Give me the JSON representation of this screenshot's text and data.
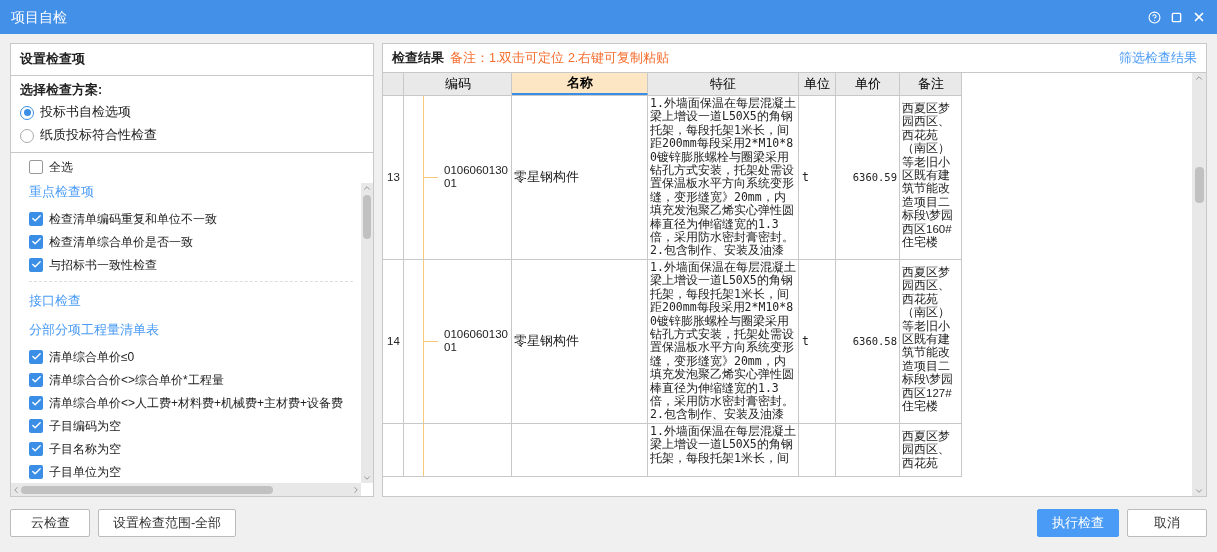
{
  "window": {
    "title": "项目自检"
  },
  "left": {
    "header": "设置检查项",
    "scheme_label": "选择检查方案:",
    "schemes": [
      {
        "label": "投标书自检选项",
        "selected": true
      },
      {
        "label": "纸质投标符合性检查",
        "selected": false
      }
    ],
    "select_all": {
      "label": "全选",
      "checked": false
    },
    "sections": [
      {
        "title": "重点检查项",
        "divider": true,
        "items": [
          {
            "label": "检查清单编码重复和单位不一致",
            "checked": true
          },
          {
            "label": "检查清单综合单价是否一致",
            "checked": true
          },
          {
            "label": "与招标书一致性检查",
            "checked": true
          }
        ]
      },
      {
        "title": "接口检查",
        "divider": false
      },
      {
        "title": "分部分项工程量清单表",
        "divider": false,
        "items": [
          {
            "label": "清单综合单价≤0",
            "checked": true
          },
          {
            "label": "清单综合合价<>综合单价*工程量",
            "checked": true
          },
          {
            "label": "清单综合单价<>人工费+材料费+机械费+主材费+设备费",
            "checked": true
          },
          {
            "label": "子目编码为空",
            "checked": true
          },
          {
            "label": "子目名称为空",
            "checked": true
          },
          {
            "label": "子目单位为空",
            "checked": true
          }
        ]
      }
    ]
  },
  "right": {
    "title": "检查结果",
    "note": "备注：1.双击可定位 2.右键可复制粘贴",
    "filter_link": "筛选检查结果",
    "columns": [
      {
        "selected": false
      },
      {
        "label": "编码",
        "selected": false
      },
      {
        "label": "名称",
        "selected": true
      },
      {
        "label": "特征",
        "selected": false
      },
      {
        "label": "单位",
        "selected": false
      },
      {
        "label": "单价",
        "selected": false
      },
      {
        "label": "备注",
        "selected": false
      }
    ],
    "rows": [
      {
        "number": "13",
        "code": "010606013001",
        "name": "零星钢构件",
        "feature": "1.外墙面保温在每层混凝土梁上增设一道L50X5的角钢托架，每段托架1米长，间距200mm每段采用2*M10*80镀锌膨胀螺栓与圈梁采用钻孔方式安装，托架处需设置保温板水平方向系统变形缝，变形缝宽》20mm，内填充发泡聚乙烯实心弹性圆棒直径为伸缩缝宽的1.3倍，采用防水密封膏密封。\n2.包含制作、安装及油漆",
        "unit": "t",
        "price": "6360.59",
        "remark": "西夏区梦园西区、西花苑（南区）等老旧小区既有建筑节能改造项目二标段\\梦园西区160#住宅楼"
      },
      {
        "number": "14",
        "code": "010606013001",
        "name": "零星钢构件",
        "feature": "1.外墙面保温在每层混凝土梁上增设一道L50X5的角钢托架，每段托架1米长，间距200mm每段采用2*M10*80镀锌膨胀螺栓与圈梁采用钻孔方式安装，托架处需设置保温板水平方向系统变形缝，变形缝宽》20mm，内填充发泡聚乙烯实心弹性圆棒直径为伸缩缝宽的1.3倍，采用防水密封膏密封。\n2.包含制作、安装及油漆",
        "unit": "t",
        "price": "6360.58",
        "remark": "西夏区梦园西区、西花苑（南区）等老旧小区既有建筑节能改造项目二标段\\梦园西区127#住宅楼"
      },
      {
        "number": "",
        "code": "",
        "name": "",
        "feature": "1.外墙面保温在每层混凝土梁上增设一道L50X5的角钢托架，每段托架1米长，间",
        "unit": "",
        "price": "",
        "remark": "西夏区梦园西区、西花苑"
      }
    ]
  },
  "buttons_left": [
    {
      "label": "云检查",
      "kind": "default"
    },
    {
      "label": "设置检查范围-全部",
      "kind": "default"
    }
  ],
  "buttons_right": [
    {
      "label": "执行检查",
      "kind": "primary"
    },
    {
      "label": "取消",
      "kind": "default"
    }
  ]
}
